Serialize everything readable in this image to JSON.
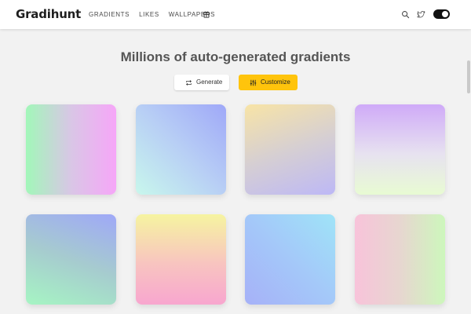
{
  "header": {
    "logo": "Gradihunt",
    "nav": [
      "GRADIENTS",
      "LIKES",
      "WALLPAPERS"
    ],
    "nav_icon": "gift-icon",
    "right_icons": [
      "search-icon",
      "twitter-icon"
    ],
    "theme_toggle": "dark-mode-toggle"
  },
  "hero": {
    "title": "Millions of auto-generated gradients",
    "generate_label": "Generate",
    "customize_label": "Customize"
  },
  "colors": {
    "accent": "#ffc40c",
    "background": "#f2f2f2",
    "title": "#555555"
  },
  "gradients": [
    {
      "from": "#a2f7b9",
      "to": "#f6a6f8"
    },
    {
      "from": "#9fa8f8",
      "to": "#c8f7ec"
    },
    {
      "from": "#f8e4a6",
      "to": "#bdb8f6"
    },
    {
      "from": "#cfaaf8",
      "to": "#e8fbd3"
    },
    {
      "from": "#9fa8f8",
      "to": "#a6f5c3"
    },
    {
      "from": "#f6f4a0",
      "to": "#f8a6cf"
    },
    {
      "from": "#9fe4f8",
      "to": "#a6b1f8"
    },
    {
      "from": "#f8c3da",
      "to": "#cdf7bc"
    }
  ]
}
